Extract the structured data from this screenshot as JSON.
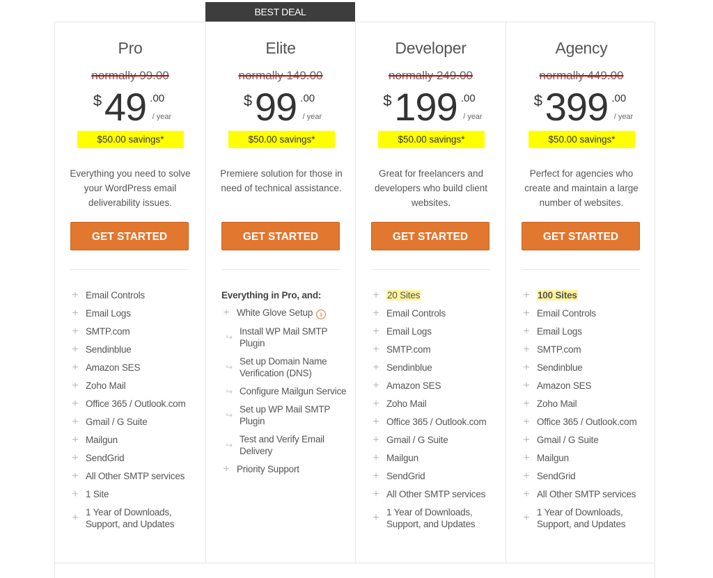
{
  "badge": "BEST DEAL",
  "plans": [
    {
      "name": "Pro",
      "normally": "normally 99.00",
      "currency": "$",
      "amount": "49",
      "cents": ".00",
      "period": "/ year",
      "savings": "$50.00 savings*",
      "description": "Everything you need to solve your WordPress email deliverability issues.",
      "cta": "GET STARTED",
      "features": [
        {
          "text": "Email Controls",
          "icon": "plus-icon"
        },
        {
          "text": "Email Logs",
          "icon": "plus-icon"
        },
        {
          "text": "SMTP.com",
          "icon": "plus-icon"
        },
        {
          "text": "Sendinblue",
          "icon": "plus-icon"
        },
        {
          "text": "Amazon SES",
          "icon": "plus-icon"
        },
        {
          "text": "Zoho Mail",
          "icon": "plus-icon"
        },
        {
          "text": "Office 365 / Outlook.com",
          "icon": "plus-icon"
        },
        {
          "text": "Gmail / G Suite",
          "icon": "plus-icon"
        },
        {
          "text": "Mailgun",
          "icon": "plus-icon"
        },
        {
          "text": "SendGrid",
          "icon": "plus-icon"
        },
        {
          "text": "All Other SMTP services",
          "icon": "plus-icon"
        },
        {
          "text": "1 Site",
          "icon": "plus-icon"
        },
        {
          "text": "1 Year of Downloads, Support, and Updates",
          "icon": "plus-icon"
        }
      ]
    },
    {
      "name": "Elite",
      "normally": "normally 149.00",
      "currency": "$",
      "amount": "99",
      "cents": ".00",
      "period": "/ year",
      "savings": "$50.00 savings*",
      "description": "Premiere solution for those in need of technical assistance.",
      "cta": "GET STARTED",
      "features_header": "Everything in Pro, and:",
      "features": [
        {
          "text": "White Glove Setup",
          "icon": "plus-icon",
          "info": true
        },
        {
          "text": "Install WP Mail SMTP Plugin",
          "icon": "sub-arrow-icon"
        },
        {
          "text": "Set up Domain Name Verification (DNS)",
          "icon": "sub-arrow-icon"
        },
        {
          "text": "Configure Mailgun Service",
          "icon": "sub-arrow-icon"
        },
        {
          "text": "Set up WP Mail SMTP Plugin",
          "icon": "sub-arrow-icon"
        },
        {
          "text": "Test and Verify Email Delivery",
          "icon": "sub-arrow-icon"
        },
        {
          "text": "Priority Support",
          "icon": "plus-icon"
        }
      ]
    },
    {
      "name": "Developer",
      "normally": "normally 249.00",
      "currency": "$",
      "amount": "199",
      "cents": ".00",
      "period": "/ year",
      "savings": "$50.00 savings*",
      "description": "Great for freelancers and developers who build client websites.",
      "cta": "GET STARTED",
      "features": [
        {
          "text": "20 Sites",
          "icon": "plus-icon",
          "highlight": true
        },
        {
          "text": "Email Controls",
          "icon": "plus-icon"
        },
        {
          "text": "Email Logs",
          "icon": "plus-icon"
        },
        {
          "text": "SMTP.com",
          "icon": "plus-icon"
        },
        {
          "text": "Sendinblue",
          "icon": "plus-icon"
        },
        {
          "text": "Amazon SES",
          "icon": "plus-icon"
        },
        {
          "text": "Zoho Mail",
          "icon": "plus-icon"
        },
        {
          "text": "Office 365 / Outlook.com",
          "icon": "plus-icon"
        },
        {
          "text": "Gmail / G Suite",
          "icon": "plus-icon"
        },
        {
          "text": "Mailgun",
          "icon": "plus-icon"
        },
        {
          "text": "SendGrid",
          "icon": "plus-icon"
        },
        {
          "text": "All Other SMTP services",
          "icon": "plus-icon"
        },
        {
          "text": "1 Year of Downloads, Support, and Updates",
          "icon": "plus-icon"
        }
      ]
    },
    {
      "name": "Agency",
      "normally": "normally 449.00",
      "currency": "$",
      "amount": "399",
      "cents": ".00",
      "period": "/ year",
      "savings": "$50.00 savings*",
      "description": "Perfect for agencies who create and maintain a large number of websites.",
      "cta": "GET STARTED",
      "features": [
        {
          "text": "100 Sites",
          "icon": "plus-icon",
          "highlight": true,
          "bold": true
        },
        {
          "text": "Email Controls",
          "icon": "plus-icon"
        },
        {
          "text": "Email Logs",
          "icon": "plus-icon"
        },
        {
          "text": "SMTP.com",
          "icon": "plus-icon"
        },
        {
          "text": "Sendinblue",
          "icon": "plus-icon"
        },
        {
          "text": "Amazon SES",
          "icon": "plus-icon"
        },
        {
          "text": "Zoho Mail",
          "icon": "plus-icon"
        },
        {
          "text": "Office 365 / Outlook.com",
          "icon": "plus-icon"
        },
        {
          "text": "Gmail / G Suite",
          "icon": "plus-icon"
        },
        {
          "text": "Mailgun",
          "icon": "plus-icon"
        },
        {
          "text": "SendGrid",
          "icon": "plus-icon"
        },
        {
          "text": "All Other SMTP services",
          "icon": "plus-icon"
        },
        {
          "text": "1 Year of Downloads, Support, and Updates",
          "icon": "plus-icon"
        }
      ]
    }
  ],
  "colors": {
    "accent": "#e27730",
    "badge_bg": "#3d3d3d",
    "savings_bg": "#ffff00",
    "highlight_bg": "#fff59a",
    "strike": "#cc0000"
  }
}
